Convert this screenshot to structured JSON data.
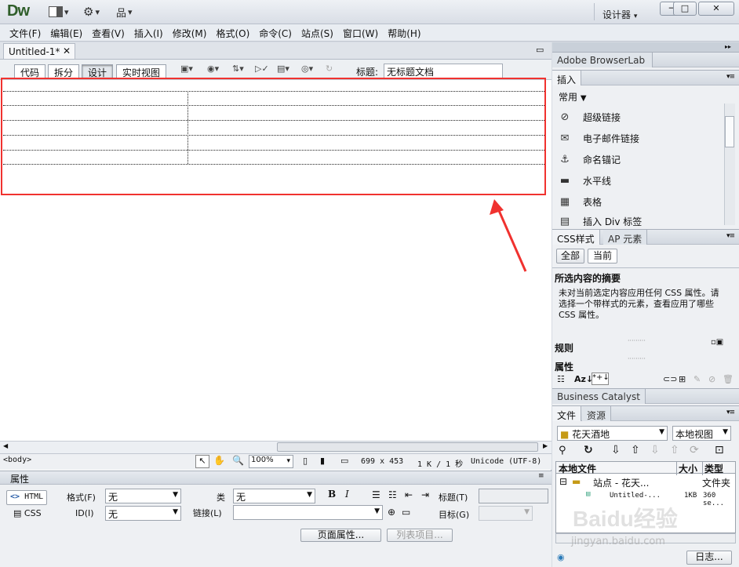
{
  "app": {
    "logo": "Dw",
    "workspace": "设计器"
  },
  "titlebar": {
    "layout_icon": "layout-icon",
    "extend_icon": "gear-icon",
    "site_icon": "site-icon",
    "min": "─",
    "max": "□",
    "close": "✕"
  },
  "menu": [
    "文件(F)",
    "编辑(E)",
    "查看(V)",
    "插入(I)",
    "修改(M)",
    "格式(O)",
    "命令(C)",
    "站点(S)",
    "窗口(W)",
    "帮助(H)"
  ],
  "document": {
    "tab_name": "Untitled-1*",
    "views": [
      "代码",
      "拆分",
      "设计",
      "实时视图"
    ],
    "active_view": "设计",
    "title_label": "标题:",
    "title_value": "无标题文档"
  },
  "status": {
    "tag": "<body>",
    "zoom": "100%",
    "size": "699 x 453",
    "weight": "1 K / 1 秒",
    "encoding": "Unicode (UTF-8)"
  },
  "properties": {
    "header": "属性",
    "html_btn": "HTML",
    "css_btn": "CSS",
    "format_label": "格式(F)",
    "format_value": "无",
    "id_label": "ID(I)",
    "id_value": "无",
    "class_label": "类",
    "class_value": "无",
    "link_label": "链接(L)",
    "bold": "B",
    "italic": "I",
    "title_label": "标题(T)",
    "target_label": "目标(G)",
    "page_props_btn": "页面属性...",
    "list_item_btn": "列表项目..."
  },
  "right": {
    "browserlab": "Adobe BrowserLab",
    "insert_tab": "插入",
    "insert_category": "常用",
    "insert_items": [
      {
        "icon": "hyperlink-icon",
        "label": "超级链接"
      },
      {
        "icon": "email-link-icon",
        "label": "电子邮件链接"
      },
      {
        "icon": "anchor-icon",
        "label": "命名锚记"
      },
      {
        "icon": "hr-icon",
        "label": "水平线"
      },
      {
        "icon": "table-icon",
        "label": "表格"
      },
      {
        "icon": "div-icon",
        "label": "插入 Div 标签"
      }
    ],
    "css_tab": "CSS样式",
    "ap_tab": "AP 元素",
    "css_all": "全部",
    "css_current": "当前",
    "summary_title": "所选内容的摘要",
    "summary_text": "未对当前选定内容应用任何 CSS 属性。请选择一个带样式的元素，查看应用了哪些 CSS 属性。",
    "rules": "规则",
    "props": "属性",
    "business": "Business Catalyst",
    "files_tab": "文件",
    "assets_tab": "资源",
    "site_select": "花天酒地",
    "view_select": "本地视图",
    "files_cols": [
      "本地文件",
      "大小",
      "类型"
    ],
    "files_rows": [
      {
        "name": "站点 - 花天...",
        "size": "",
        "type": "文件夹"
      },
      {
        "name": "Untitled-...",
        "size": "1KB",
        "type": "360 se..."
      }
    ],
    "log_btn": "日志..."
  },
  "watermark": "Baidu经验",
  "watermark_url": "jingyan.baidu.com"
}
